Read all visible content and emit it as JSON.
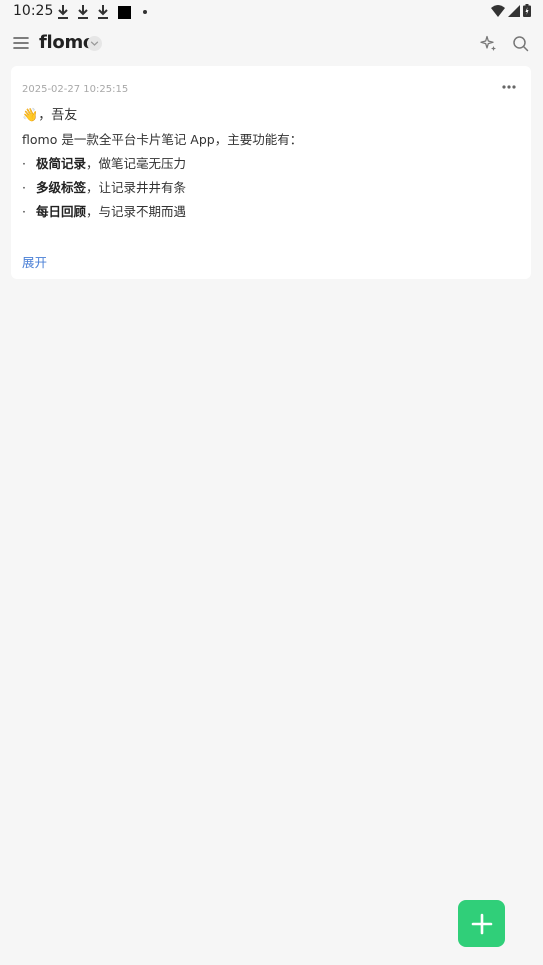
{
  "status_bar": {
    "time": "10:25"
  },
  "header": {
    "title": "flomo",
    "icons": [
      "menu-icon",
      "chevron-down-icon",
      "sparkle-icon",
      "search-icon"
    ]
  },
  "memo": {
    "timestamp": "2025-02-27 10:25:15",
    "greeting_emoji": "👋",
    "greeting_text": "，吾友",
    "intro": "flomo 是一款全平台卡片笔记 App，主要功能有：",
    "bullets": [
      {
        "bold": "极简记录",
        "rest": "，做笔记毫无压力"
      },
      {
        "bold": "多级标签",
        "rest": "，让记录井井有条"
      },
      {
        "bold": "每日回顾",
        "rest": "，与记录不期而遇"
      }
    ],
    "bullet_symbol": "·",
    "expand_label": "展开"
  },
  "colors": {
    "background": "#f6f6f6",
    "card": "#ffffff",
    "accent_green": "#30cf79",
    "link_blue": "#4a7fd6"
  }
}
